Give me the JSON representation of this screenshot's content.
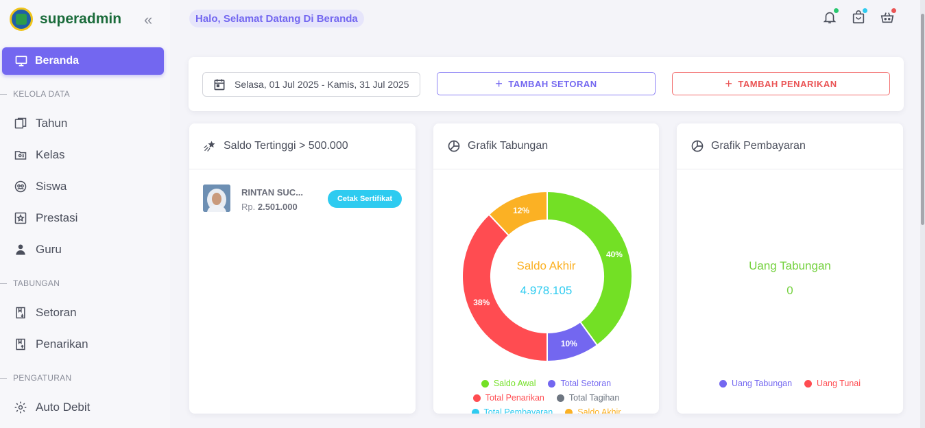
{
  "brand": {
    "name": "superadmin"
  },
  "sidebar": {
    "active": {
      "label": "Beranda"
    },
    "sections": [
      {
        "label": "KELOLA DATA"
      },
      {
        "label": "TABUNGAN"
      },
      {
        "label": "PENGATURAN"
      }
    ],
    "items": [
      {
        "label": "Tahun",
        "icon": "calendar-copy-icon"
      },
      {
        "label": "Kelas",
        "icon": "folder-user-icon"
      },
      {
        "label": "Siswa",
        "icon": "users-icon"
      },
      {
        "label": "Prestasi",
        "icon": "star-square-icon"
      },
      {
        "label": "Guru",
        "icon": "teacher-icon"
      },
      {
        "label": "Setoran",
        "icon": "book-down-icon"
      },
      {
        "label": "Penarikan",
        "icon": "book-up-icon"
      },
      {
        "label": "Auto Debit",
        "icon": "gear-icon"
      }
    ]
  },
  "header": {
    "greeting": "Halo, Selamat Datang Di Beranda",
    "colors": {
      "bell_dot": "#28c76f",
      "bag_dot": "#2ecbf0",
      "basket_dot": "#ea5455"
    }
  },
  "filter": {
    "date_range": "Selasa, 01 Jul 2025 - Kamis, 31 Jul 2025",
    "add_deposit": "TAMBAH SETORAN",
    "add_withdrawal": "TAMBAH PENARIKAN"
  },
  "top_balance": {
    "title": "Saldo Tertinggi > 500.000",
    "student_name": "RINTAN SUC...",
    "saldo_prefix": "Rp.",
    "saldo_value": "2.501.000",
    "certificate_button": "Cetak Sertifikat"
  },
  "savings_chart": {
    "title": "Grafik Tabungan",
    "center_label": "Saldo Akhir",
    "center_value": "4.978.105"
  },
  "payment_chart": {
    "title": "Grafik Pembayaran",
    "center_label": "Uang Tabungan",
    "center_value": "0"
  },
  "chart_data": [
    {
      "type": "pie",
      "title": "Grafik Tabungan",
      "categories": [
        "Saldo Awal",
        "Total Setoran",
        "Total Penarikan",
        "Total Tagihan",
        "Total Pembayaran",
        "Saldo Akhir"
      ],
      "values": [
        40,
        10,
        38,
        0,
        0,
        12
      ],
      "value_unit": "%",
      "colors": [
        "#73e025",
        "#7367f0",
        "#ff4c51",
        "#6e7681",
        "#2ecbf0",
        "#fbb124"
      ],
      "legend": "bottom"
    },
    {
      "type": "pie",
      "title": "Grafik Pembayaran",
      "categories": [
        "Uang Tabungan",
        "Uang Tunai"
      ],
      "values": [
        0,
        0
      ],
      "colors": [
        "#7367f0",
        "#ff4c51"
      ],
      "legend": "bottom"
    }
  ]
}
